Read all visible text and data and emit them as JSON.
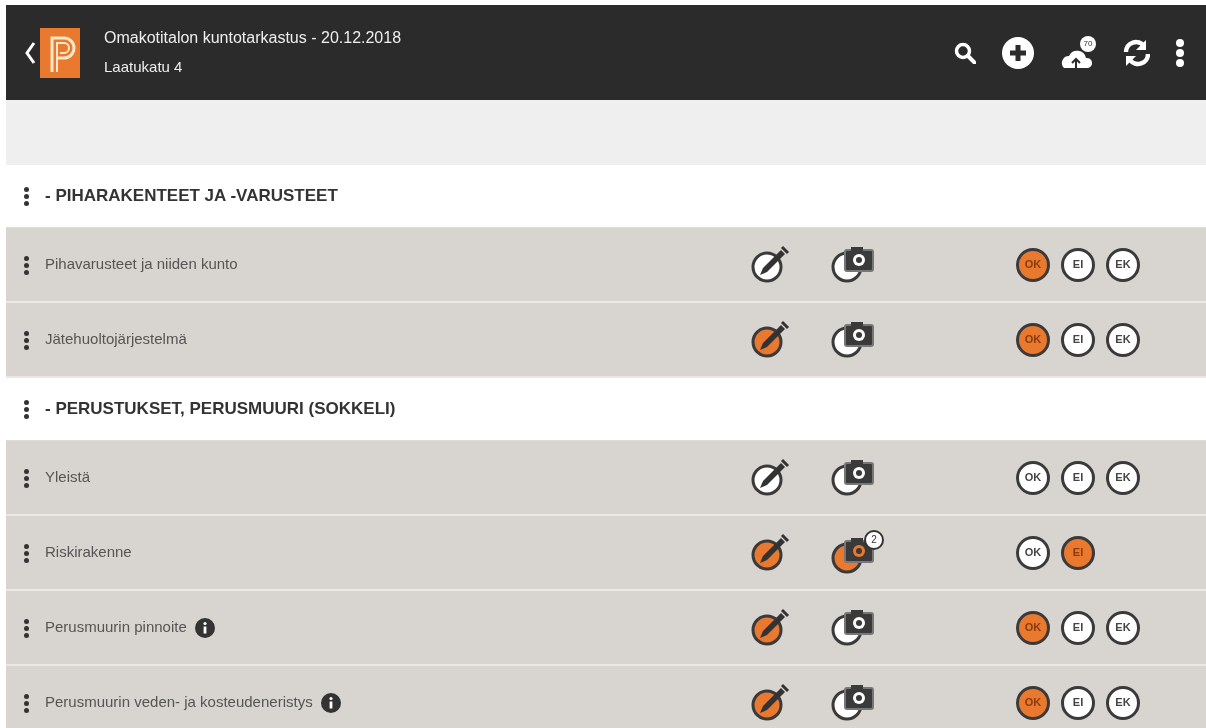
{
  "header": {
    "title": "Omakotitalon kuntotarkastus  - 20.12.2018",
    "subtitle": "Laatukatu 4",
    "sync_badge": "70"
  },
  "sections": [
    {
      "title": "- PIHARAKENTEET JA -VARUSTEET",
      "items": [
        {
          "label": "Pihavarusteet ja niiden kunto",
          "info": false,
          "note_filled": false,
          "photo_filled": false,
          "answers": [
            {
              "label": "OK",
              "selected": true
            },
            {
              "label": "EI",
              "selected": false
            },
            {
              "label": "EK",
              "selected": false
            }
          ]
        },
        {
          "label": "Jätehuoltojärjestelmä",
          "info": false,
          "note_filled": true,
          "photo_filled": false,
          "answers": [
            {
              "label": "OK",
              "selected": true
            },
            {
              "label": "EI",
              "selected": false
            },
            {
              "label": "EK",
              "selected": false
            }
          ]
        }
      ]
    },
    {
      "title": "- PERUSTUKSET, PERUSMUURI (SOKKELI)",
      "items": [
        {
          "label": "Yleistä",
          "info": false,
          "note_filled": false,
          "photo_filled": false,
          "answers": [
            {
              "label": "OK",
              "selected": false
            },
            {
              "label": "EI",
              "selected": false
            },
            {
              "label": "EK",
              "selected": false
            }
          ]
        },
        {
          "label": "Riskirakenne",
          "info": false,
          "note_filled": true,
          "photo_filled": true,
          "photo_count": "2",
          "answers": [
            {
              "label": "OK",
              "selected": false
            },
            {
              "label": "EI",
              "selected": true
            }
          ]
        },
        {
          "label": "Perusmuurin pinnoite",
          "info": true,
          "note_filled": true,
          "photo_filled": false,
          "answers": [
            {
              "label": "OK",
              "selected": true
            },
            {
              "label": "EI",
              "selected": false
            },
            {
              "label": "EK",
              "selected": false
            }
          ]
        },
        {
          "label": "Perusmuurin veden- ja kosteudeneristys",
          "info": true,
          "note_filled": true,
          "photo_filled": false,
          "answers": [
            {
              "label": "OK",
              "selected": true
            },
            {
              "label": "EI",
              "selected": false
            },
            {
              "label": "EK",
              "selected": false
            }
          ]
        }
      ]
    }
  ]
}
